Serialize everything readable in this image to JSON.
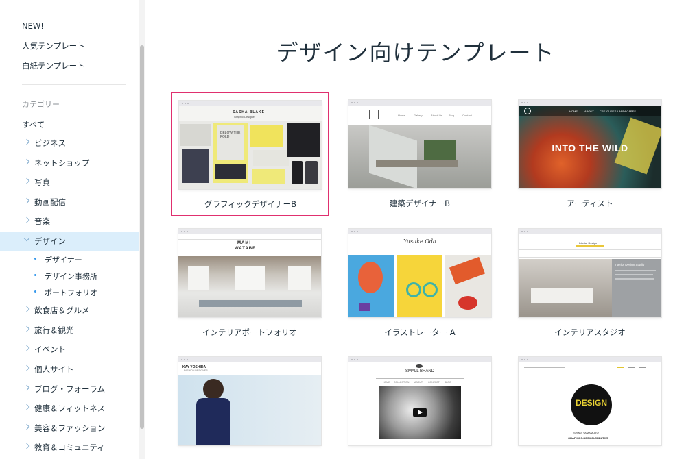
{
  "sidebar": {
    "top_links": [
      "NEW!",
      "人気テンプレート",
      "白紙テンプレート"
    ],
    "category_heading": "カテゴリー",
    "all_label": "すべて",
    "categories": [
      "ビジネス",
      "ネットショップ",
      "写真",
      "動画配信",
      "音楽",
      "デザイン",
      "飲食店＆グルメ",
      "旅行＆観光",
      "イベント",
      "個人サイト",
      "ブログ・フォーラム",
      "健康＆フィットネス",
      "美容＆ファッション",
      "教育＆コミュニティ"
    ],
    "selected_category": "デザイン",
    "subcategories": [
      "デザイナー",
      "デザイン事務所",
      "ポートフォリオ"
    ]
  },
  "main": {
    "title": "デザイン向けテンプレート",
    "templates": [
      {
        "label": "グラフィックデザイナーB",
        "selected": true,
        "preview_name": "SASHA BLAKE",
        "preview_sub": "Graphic Designer",
        "preview_book": "BELOW THE FOLD"
      },
      {
        "label": "建築デザイナーB",
        "selected": false,
        "preview_nav": [
          "Home",
          "Gallery",
          "About Us",
          "Blog",
          "Contact"
        ]
      },
      {
        "label": "アーティスト",
        "selected": false,
        "preview_headline": "INTO THE WILD",
        "preview_nav": [
          "HOME",
          "ABOUT",
          "CREATURES",
          "LANDSCAPES"
        ]
      },
      {
        "label": "インテリアポートフォリオ",
        "selected": false,
        "preview_name_1": "MAMI",
        "preview_name_2": "WATABE"
      },
      {
        "label": "イラストレーター A",
        "selected": false,
        "preview_name": "Yusuke Oda"
      },
      {
        "label": "インテリアスタジオ",
        "selected": false,
        "preview_brand": "Interior Design",
        "preview_sub": "Interior Design Studio"
      },
      {
        "label": "",
        "selected": false,
        "preview_name": "KAY YOSHIDA",
        "preview_sub": "FASHION DESIGNER"
      },
      {
        "label": "",
        "selected": false,
        "preview_brand": "SMALL BRAND",
        "preview_nav": [
          "HOME",
          "COLLECTION",
          "ABOUT",
          "CONTACT",
          "BLOG"
        ]
      },
      {
        "label": "",
        "selected": false,
        "preview_logo": "DESIGN",
        "preview_name": "SHINJI YAMAMOTO",
        "preview_sub": "GRAPHICS-DESIGN-CREATIVE"
      }
    ]
  },
  "colors": {
    "accent": "#3899ec",
    "selected_border": "#e0306f",
    "selected_bg": "#dbeefb"
  }
}
